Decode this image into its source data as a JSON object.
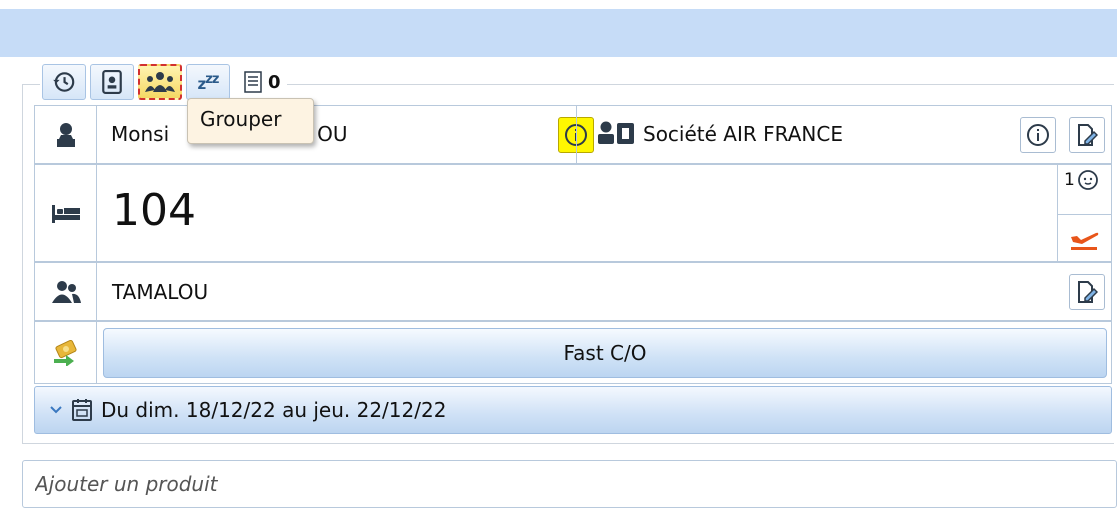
{
  "toolbar": {
    "notes_count": "0",
    "tooltip": "Grouper"
  },
  "guest": {
    "name": "Monsi",
    "name_end": "OU",
    "company": "Société AIR FRANCE"
  },
  "room": {
    "number": "104",
    "pax_count": "1"
  },
  "group": {
    "name": "TAMALOU"
  },
  "actions": {
    "fast_checkout": "Fast C/O"
  },
  "stay": {
    "dates": "Du dim. 18/12/22 au jeu. 22/12/22"
  },
  "product": {
    "placeholder": "Ajouter un produit"
  },
  "colors": {
    "header_bar": "#c6dcf7",
    "info_highlight": "#fff700",
    "departure_icon": "#e8551a",
    "icon_dark": "#2d3b4a"
  }
}
